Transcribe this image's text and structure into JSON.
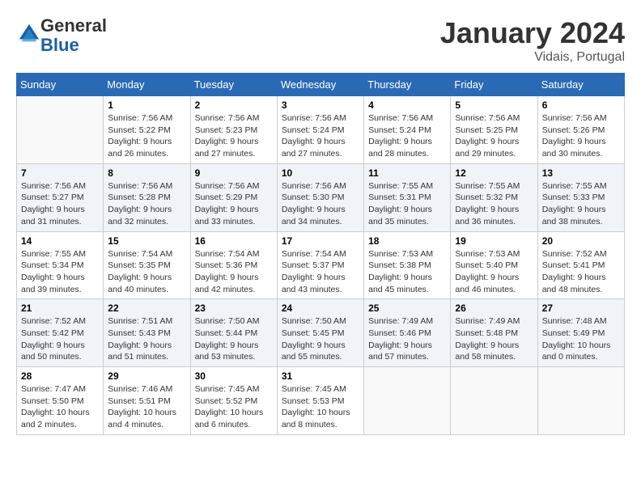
{
  "logo": {
    "general": "General",
    "blue": "Blue"
  },
  "header": {
    "month": "January 2024",
    "location": "Vidais, Portugal"
  },
  "columns": [
    "Sunday",
    "Monday",
    "Tuesday",
    "Wednesday",
    "Thursday",
    "Friday",
    "Saturday"
  ],
  "weeks": [
    [
      {
        "day": "",
        "sunrise": "",
        "sunset": "",
        "daylight": ""
      },
      {
        "day": "1",
        "sunrise": "Sunrise: 7:56 AM",
        "sunset": "Sunset: 5:22 PM",
        "daylight": "Daylight: 9 hours and 26 minutes."
      },
      {
        "day": "2",
        "sunrise": "Sunrise: 7:56 AM",
        "sunset": "Sunset: 5:23 PM",
        "daylight": "Daylight: 9 hours and 27 minutes."
      },
      {
        "day": "3",
        "sunrise": "Sunrise: 7:56 AM",
        "sunset": "Sunset: 5:24 PM",
        "daylight": "Daylight: 9 hours and 27 minutes."
      },
      {
        "day": "4",
        "sunrise": "Sunrise: 7:56 AM",
        "sunset": "Sunset: 5:24 PM",
        "daylight": "Daylight: 9 hours and 28 minutes."
      },
      {
        "day": "5",
        "sunrise": "Sunrise: 7:56 AM",
        "sunset": "Sunset: 5:25 PM",
        "daylight": "Daylight: 9 hours and 29 minutes."
      },
      {
        "day": "6",
        "sunrise": "Sunrise: 7:56 AM",
        "sunset": "Sunset: 5:26 PM",
        "daylight": "Daylight: 9 hours and 30 minutes."
      }
    ],
    [
      {
        "day": "7",
        "sunrise": "Sunrise: 7:56 AM",
        "sunset": "Sunset: 5:27 PM",
        "daylight": "Daylight: 9 hours and 31 minutes."
      },
      {
        "day": "8",
        "sunrise": "Sunrise: 7:56 AM",
        "sunset": "Sunset: 5:28 PM",
        "daylight": "Daylight: 9 hours and 32 minutes."
      },
      {
        "day": "9",
        "sunrise": "Sunrise: 7:56 AM",
        "sunset": "Sunset: 5:29 PM",
        "daylight": "Daylight: 9 hours and 33 minutes."
      },
      {
        "day": "10",
        "sunrise": "Sunrise: 7:56 AM",
        "sunset": "Sunset: 5:30 PM",
        "daylight": "Daylight: 9 hours and 34 minutes."
      },
      {
        "day": "11",
        "sunrise": "Sunrise: 7:55 AM",
        "sunset": "Sunset: 5:31 PM",
        "daylight": "Daylight: 9 hours and 35 minutes."
      },
      {
        "day": "12",
        "sunrise": "Sunrise: 7:55 AM",
        "sunset": "Sunset: 5:32 PM",
        "daylight": "Daylight: 9 hours and 36 minutes."
      },
      {
        "day": "13",
        "sunrise": "Sunrise: 7:55 AM",
        "sunset": "Sunset: 5:33 PM",
        "daylight": "Daylight: 9 hours and 38 minutes."
      }
    ],
    [
      {
        "day": "14",
        "sunrise": "Sunrise: 7:55 AM",
        "sunset": "Sunset: 5:34 PM",
        "daylight": "Daylight: 9 hours and 39 minutes."
      },
      {
        "day": "15",
        "sunrise": "Sunrise: 7:54 AM",
        "sunset": "Sunset: 5:35 PM",
        "daylight": "Daylight: 9 hours and 40 minutes."
      },
      {
        "day": "16",
        "sunrise": "Sunrise: 7:54 AM",
        "sunset": "Sunset: 5:36 PM",
        "daylight": "Daylight: 9 hours and 42 minutes."
      },
      {
        "day": "17",
        "sunrise": "Sunrise: 7:54 AM",
        "sunset": "Sunset: 5:37 PM",
        "daylight": "Daylight: 9 hours and 43 minutes."
      },
      {
        "day": "18",
        "sunrise": "Sunrise: 7:53 AM",
        "sunset": "Sunset: 5:38 PM",
        "daylight": "Daylight: 9 hours and 45 minutes."
      },
      {
        "day": "19",
        "sunrise": "Sunrise: 7:53 AM",
        "sunset": "Sunset: 5:40 PM",
        "daylight": "Daylight: 9 hours and 46 minutes."
      },
      {
        "day": "20",
        "sunrise": "Sunrise: 7:52 AM",
        "sunset": "Sunset: 5:41 PM",
        "daylight": "Daylight: 9 hours and 48 minutes."
      }
    ],
    [
      {
        "day": "21",
        "sunrise": "Sunrise: 7:52 AM",
        "sunset": "Sunset: 5:42 PM",
        "daylight": "Daylight: 9 hours and 50 minutes."
      },
      {
        "day": "22",
        "sunrise": "Sunrise: 7:51 AM",
        "sunset": "Sunset: 5:43 PM",
        "daylight": "Daylight: 9 hours and 51 minutes."
      },
      {
        "day": "23",
        "sunrise": "Sunrise: 7:50 AM",
        "sunset": "Sunset: 5:44 PM",
        "daylight": "Daylight: 9 hours and 53 minutes."
      },
      {
        "day": "24",
        "sunrise": "Sunrise: 7:50 AM",
        "sunset": "Sunset: 5:45 PM",
        "daylight": "Daylight: 9 hours and 55 minutes."
      },
      {
        "day": "25",
        "sunrise": "Sunrise: 7:49 AM",
        "sunset": "Sunset: 5:46 PM",
        "daylight": "Daylight: 9 hours and 57 minutes."
      },
      {
        "day": "26",
        "sunrise": "Sunrise: 7:49 AM",
        "sunset": "Sunset: 5:48 PM",
        "daylight": "Daylight: 9 hours and 58 minutes."
      },
      {
        "day": "27",
        "sunrise": "Sunrise: 7:48 AM",
        "sunset": "Sunset: 5:49 PM",
        "daylight": "Daylight: 10 hours and 0 minutes."
      }
    ],
    [
      {
        "day": "28",
        "sunrise": "Sunrise: 7:47 AM",
        "sunset": "Sunset: 5:50 PM",
        "daylight": "Daylight: 10 hours and 2 minutes."
      },
      {
        "day": "29",
        "sunrise": "Sunrise: 7:46 AM",
        "sunset": "Sunset: 5:51 PM",
        "daylight": "Daylight: 10 hours and 4 minutes."
      },
      {
        "day": "30",
        "sunrise": "Sunrise: 7:45 AM",
        "sunset": "Sunset: 5:52 PM",
        "daylight": "Daylight: 10 hours and 6 minutes."
      },
      {
        "day": "31",
        "sunrise": "Sunrise: 7:45 AM",
        "sunset": "Sunset: 5:53 PM",
        "daylight": "Daylight: 10 hours and 8 minutes."
      },
      {
        "day": "",
        "sunrise": "",
        "sunset": "",
        "daylight": ""
      },
      {
        "day": "",
        "sunrise": "",
        "sunset": "",
        "daylight": ""
      },
      {
        "day": "",
        "sunrise": "",
        "sunset": "",
        "daylight": ""
      }
    ]
  ]
}
